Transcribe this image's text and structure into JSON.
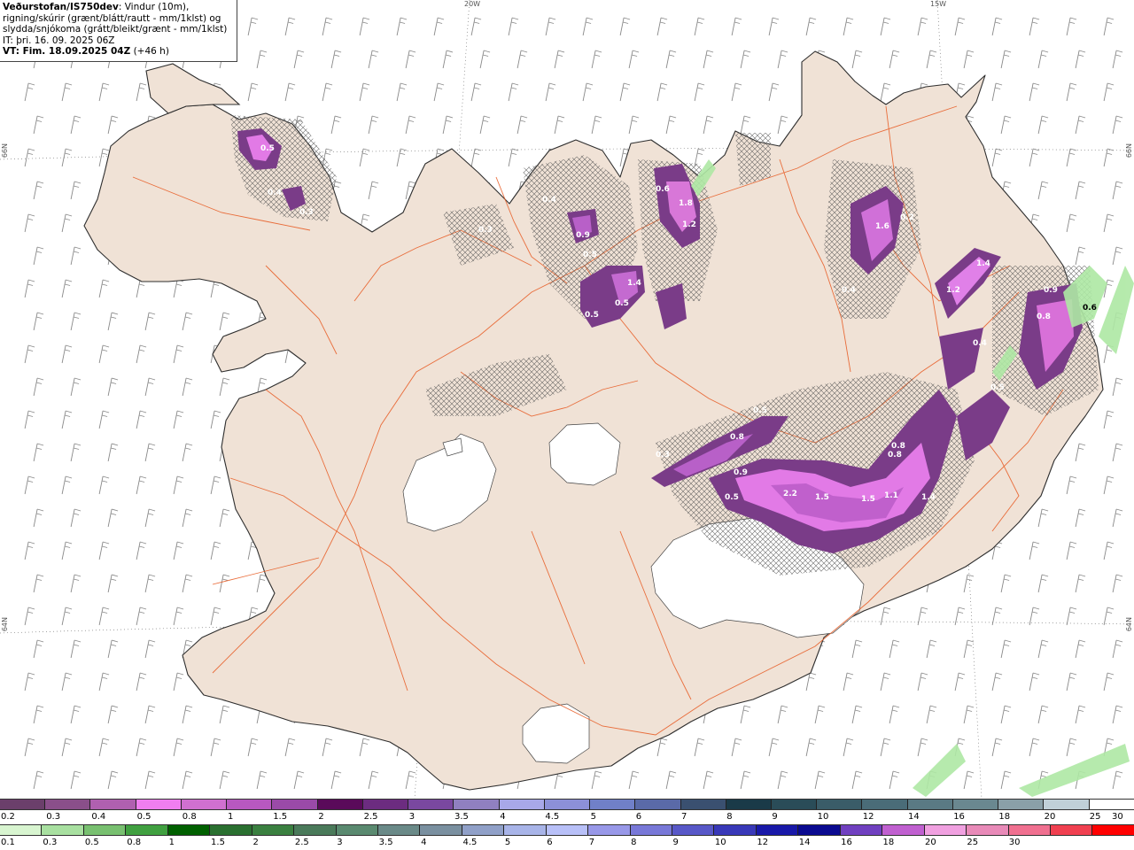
{
  "header": {
    "org": "Veðurstofan/IS750dev",
    "line1_rest": ": Vindur (10m),",
    "line2": "rigning/skúrir (grænt/blátt/rautt - mm/1klst) og",
    "line3": "slydda/snjókoma (grátt/bleikt/grænt - mm/1klst)",
    "it": "IT: þri. 16. 09. 2025 06Z",
    "vt_label": "VT: Fim. 18.09.2025 04Z",
    "vt_lead": "(+46 h)"
  },
  "grid_labels": {
    "lon_20w": "20W",
    "lon_15w": "15W",
    "lat_66n": "66N",
    "lat_64n": "64N"
  },
  "precip_labels": [
    "0.5",
    "0.4",
    "0.3",
    "0.4",
    "0.9",
    "0.5",
    "0.5",
    "1.4",
    "0.5",
    "0.6",
    "1.8",
    "1.2",
    "1.6",
    "0.2",
    "1.4",
    "1.2",
    "0.9",
    "0.6",
    "0.8",
    "0.4",
    "0.5",
    "0.3",
    "0.8",
    "0.9",
    "0.5",
    "2.2",
    "1.5",
    "1.5",
    "1.1",
    "1.4",
    "0.8",
    "0.8",
    "0.5",
    "0.3",
    "0.4"
  ],
  "colorbar_snow": {
    "colors": [
      "#6b3f6b",
      "#8a4f8a",
      "#b060b0",
      "#f07ef0",
      "#d070d0",
      "#b858c0",
      "#9a4aa8",
      "#5a0a5a",
      "#6c2c80",
      "#7a48a0",
      "#9080c0",
      "#a8a8e8",
      "#8c90d8",
      "#7080c8",
      "#5a6aa8",
      "#3a5070",
      "#1a3a48",
      "#2a4c58",
      "#3a5c68",
      "#4a6c78",
      "#5a7a84",
      "#6a8890",
      "#8aa0a8",
      "#c0d0d8",
      "#ffffff"
    ],
    "ticks": [
      "0.2",
      "0.3",
      "0.4",
      "0.5",
      "0.8",
      "1",
      "1.5",
      "2",
      "2.5",
      "3",
      "3.5",
      "4",
      "4.5",
      "5",
      "6",
      "7",
      "8",
      "9",
      "10",
      "12",
      "14",
      "16",
      "18",
      "20",
      "25",
      "30"
    ]
  },
  "colorbar_rain": {
    "colors": [
      "#d8f5d0",
      "#a8e0a0",
      "#78c070",
      "#40a040",
      "#006000",
      "#2a7030",
      "#3a8040",
      "#4a7a5a",
      "#5a8a70",
      "#6a8a88",
      "#7a90a0",
      "#90a0c8",
      "#a8b4e8",
      "#b8c0f8",
      "#9898e8",
      "#7878d8",
      "#5858c8",
      "#3838b8",
      "#1818a8",
      "#0a0a90",
      "#7040c0",
      "#c060d0",
      "#f0a0e0",
      "#e88ab8",
      "#f07090",
      "#f04050",
      "#ff0000"
    ],
    "ticks": [
      "0.1",
      "0.3",
      "0.5",
      "0.8",
      "1",
      "1.5",
      "2",
      "2.5",
      "3",
      "3.5",
      "4",
      "4.5",
      "5",
      "6",
      "7",
      "8",
      "9",
      "10",
      "12",
      "14",
      "16",
      "18",
      "20",
      "25",
      "30"
    ]
  },
  "colors": {
    "land": "#f0e2d6",
    "coast": "#333333",
    "roads": "#e8602a",
    "glacier": "#ffffff",
    "barbs": "#888888"
  }
}
